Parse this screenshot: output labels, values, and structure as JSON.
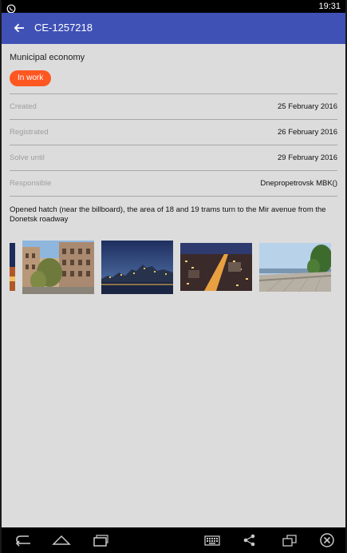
{
  "status_bar": {
    "time": "19:31",
    "notification_icon": "whatsapp-icon"
  },
  "app_bar": {
    "back_icon": "arrow-back-icon",
    "title": "CE-1257218"
  },
  "issue": {
    "category": "Municipal economy",
    "status": "In work",
    "status_color": "#ff5722",
    "details": [
      {
        "label": "Created",
        "value": "25 February 2016"
      },
      {
        "label": "Registrated",
        "value": "26 February 2016"
      },
      {
        "label": "Solve until",
        "value": "29 February 2016"
      },
      {
        "label": "Responsible",
        "value": "Dnepropetrovsk MBK()"
      }
    ],
    "description": "Opened hatch (near the billboard), the area of 18 and 19 trams turn to the Mir avenue from the Donetsk roadway"
  },
  "photos": [
    {
      "name": "photo-partial-night-city"
    },
    {
      "name": "photo-city-street-day"
    },
    {
      "name": "photo-city-river-dusk"
    },
    {
      "name": "photo-city-aerial-night"
    },
    {
      "name": "photo-embankment-day"
    }
  ],
  "nav_bar": {
    "icons": [
      "back-icon",
      "home-icon",
      "recent-apps-icon",
      "keyboard-icon",
      "share-icon",
      "screen-rotate-icon",
      "close-circle-icon"
    ]
  },
  "colors": {
    "app_bar": "#3f51b5",
    "background": "#dcdcdc",
    "badge": "#ff5722"
  }
}
